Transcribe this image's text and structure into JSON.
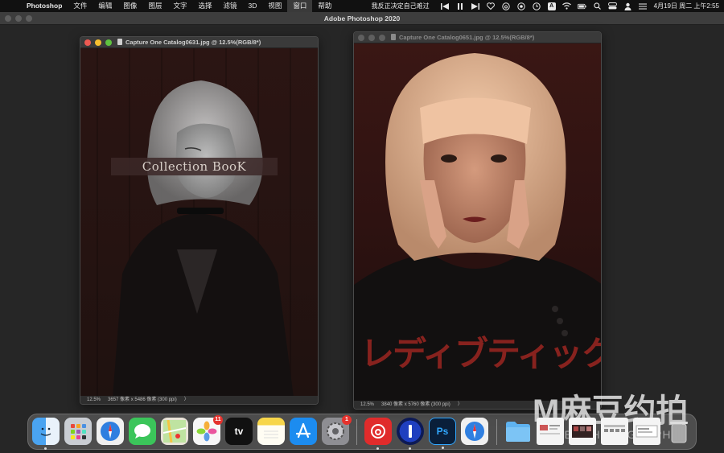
{
  "menubar": {
    "apple_glyph": "",
    "app_name": "Photoshop",
    "menus": [
      "文件",
      "编辑",
      "图像",
      "图层",
      "文字",
      "选择",
      "滤镜",
      "3D",
      "视图",
      "窗口",
      "帮助"
    ],
    "active_menu_index": 9,
    "now_playing": "我反正决定自己难过",
    "datetime": "4月19日 周二 上午2:55",
    "tray_icons": [
      "previous-icon",
      "pause-icon",
      "next-icon",
      "heart-icon",
      "netease-icon",
      "record-icon",
      "clock-icon",
      "input-a-icon",
      "wifi-icon",
      "battery-icon",
      "search-icon",
      "control-center-icon",
      "person-icon",
      "menu-extra-icon"
    ],
    "tray_a_letter": "A"
  },
  "app": {
    "title": "Adobe Photoshop 2020"
  },
  "doc_left": {
    "title": "Capture One Catalog0631.jpg @ 12.5%(RGB/8*)",
    "zoom": "12.5%",
    "info": "3657 像素 x 5486 像素 (300 ppi)",
    "arrow": "〉",
    "overlay_text": "Collection BooK",
    "active": true
  },
  "doc_right": {
    "title": "Capture One Catalog0651.jpg @ 12.5%(RGB/8*)",
    "zoom": "12.5%",
    "info": "3840 像素 x 5760 像素 (300 ppi)",
    "arrow": "〉",
    "cover_title": "レディブティック",
    "active": false
  },
  "watermark": {
    "main": "M麻豆约拍",
    "sub": "MODEL PHOTOGRAPH"
  },
  "dock": {
    "items": [
      {
        "name": "finder",
        "color": "#3d8fe6",
        "running": true
      },
      {
        "name": "launchpad",
        "color": "#c9cdd3",
        "running": false
      },
      {
        "name": "safari",
        "color": "#2f7fe0",
        "running": false
      },
      {
        "name": "messages",
        "color": "#3bc55a",
        "running": false
      },
      {
        "name": "maps",
        "color": "#6cc04a",
        "running": false
      },
      {
        "name": "photos",
        "color": "#f2f2f2",
        "running": false,
        "badge": "11"
      },
      {
        "name": "apple-tv",
        "color": "#111111",
        "running": false,
        "label": "tv"
      },
      {
        "name": "notes",
        "color": "#f7d64a",
        "running": false
      },
      {
        "name": "app-store",
        "color": "#1c8cf0",
        "running": false
      },
      {
        "name": "system-preferences",
        "color": "#8e8e93",
        "running": false,
        "badge": "1"
      },
      {
        "name": "netease-music",
        "color": "#e02b2b",
        "running": true
      },
      {
        "name": "1password",
        "color": "#1a2a8a",
        "running": true
      },
      {
        "name": "photoshop",
        "color": "#0a1f3a",
        "running": true,
        "label": "Ps"
      },
      {
        "name": "safari-technology",
        "color": "#2f7fe0",
        "running": false
      },
      {
        "name": "downloads-folder",
        "color": "#5fb3f0",
        "running": false
      },
      {
        "name": "recent-doc-1",
        "color": "#f4f4f4",
        "running": false
      },
      {
        "name": "recent-doc-2",
        "color": "#f4f4f4",
        "running": false
      },
      {
        "name": "recent-doc-3",
        "color": "#f4f4f4",
        "running": false
      },
      {
        "name": "recent-doc-4",
        "color": "#f4f4f4",
        "running": false
      },
      {
        "name": "trash",
        "color": "#d9d9d9",
        "running": false
      }
    ]
  },
  "colors": {
    "menubar_bg": "#111111",
    "close_red": "#ee5a52",
    "minimize_yellow": "#f5be2f",
    "zoom_green": "#5fc23f",
    "inactive_light": "#5f5f5f"
  }
}
